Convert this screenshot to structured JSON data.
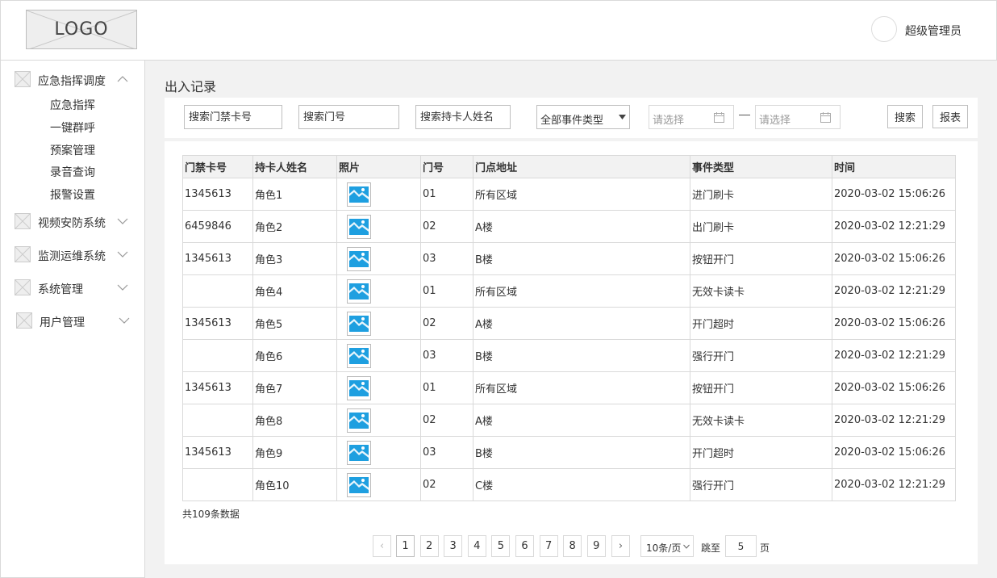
{
  "header": {
    "logo_text": "LOGO",
    "user_name": "超级管理员"
  },
  "sidebar": {
    "groups": [
      {
        "label": "应急指挥调度",
        "expanded": true,
        "icon": "placeholder-image-icon",
        "items": [
          "应急指挥",
          "一键群呼",
          "预案管理",
          "录音查询",
          "报警设置"
        ]
      },
      {
        "label": "视频安防系统",
        "expanded": false,
        "icon": "placeholder-image-icon"
      },
      {
        "label": "监测运维系统",
        "expanded": false,
        "icon": "placeholder-image-icon"
      },
      {
        "label": "系统管理",
        "expanded": false,
        "icon": "placeholder-image-icon"
      },
      {
        "label": "用户管理",
        "expanded": false,
        "icon": "placeholder-image-icon"
      }
    ]
  },
  "main": {
    "title": "出入记录",
    "filters": {
      "card_placeholder": "搜索门禁卡号",
      "door_placeholder": "搜索门号",
      "holder_placeholder": "搜索持卡人姓名",
      "event_type_selected": "全部事件类型",
      "date_start_placeholder": "请选择",
      "date_end_placeholder": "请选择",
      "search_label": "搜索",
      "report_label": "报表"
    },
    "table": {
      "columns": [
        "门禁卡号",
        "持卡人姓名",
        "照片",
        "门号",
        "门点地址",
        "事件类型",
        "时间"
      ],
      "rows": [
        {
          "card": "1345613",
          "name": "角色1",
          "door": "01",
          "address": "所有区域",
          "event": "进门刷卡",
          "time": "2020-03-02 15:06:26"
        },
        {
          "card": "6459846",
          "name": "角色2",
          "door": "02",
          "address": "A楼",
          "event": "出门刷卡",
          "time": "2020-03-02 12:21:29"
        },
        {
          "card": "1345613",
          "name": "角色3",
          "door": "03",
          "address": "B楼",
          "event": "按钮开门",
          "time": "2020-03-02 15:06:26"
        },
        {
          "card": "",
          "name": "角色4",
          "door": "01",
          "address": "所有区域",
          "event": "无效卡读卡",
          "time": "2020-03-02 12:21:29"
        },
        {
          "card": "1345613",
          "name": "角色5",
          "door": "02",
          "address": "A楼",
          "event": "开门超时",
          "time": "2020-03-02 15:06:26"
        },
        {
          "card": "",
          "name": "角色6",
          "door": "03",
          "address": "B楼",
          "event": "强行开门",
          "time": "2020-03-02 12:21:29"
        },
        {
          "card": "1345613",
          "name": "角色7",
          "door": "01",
          "address": "所有区域",
          "event": "按钮开门",
          "time": "2020-03-02 15:06:26"
        },
        {
          "card": "",
          "name": "角色8",
          "door": "02",
          "address": "A楼",
          "event": "无效卡读卡",
          "time": "2020-03-02 12:21:29"
        },
        {
          "card": "1345613",
          "name": "角色9",
          "door": "03",
          "address": "B楼",
          "event": "开门超时",
          "time": "2020-03-02 15:06:26"
        },
        {
          "card": "",
          "name": "角色10",
          "door": "02",
          "address": "C楼",
          "event": "强行开门",
          "time": "2020-03-02 12:21:29"
        }
      ]
    },
    "total_text": "共109条数据",
    "pagination": {
      "pages": [
        "1",
        "2",
        "3",
        "4",
        "5",
        "6",
        "7",
        "8",
        "9"
      ],
      "current": "1",
      "prev_label": "‹",
      "next_label": "›",
      "page_size_label": "10条/页",
      "jump_label": "跳至",
      "jump_value": "5",
      "page_suffix": "页"
    }
  },
  "colors": {
    "photo_accent": "#1e9fe0",
    "background": "#f2f2f2",
    "border": "#d9d9d9"
  }
}
